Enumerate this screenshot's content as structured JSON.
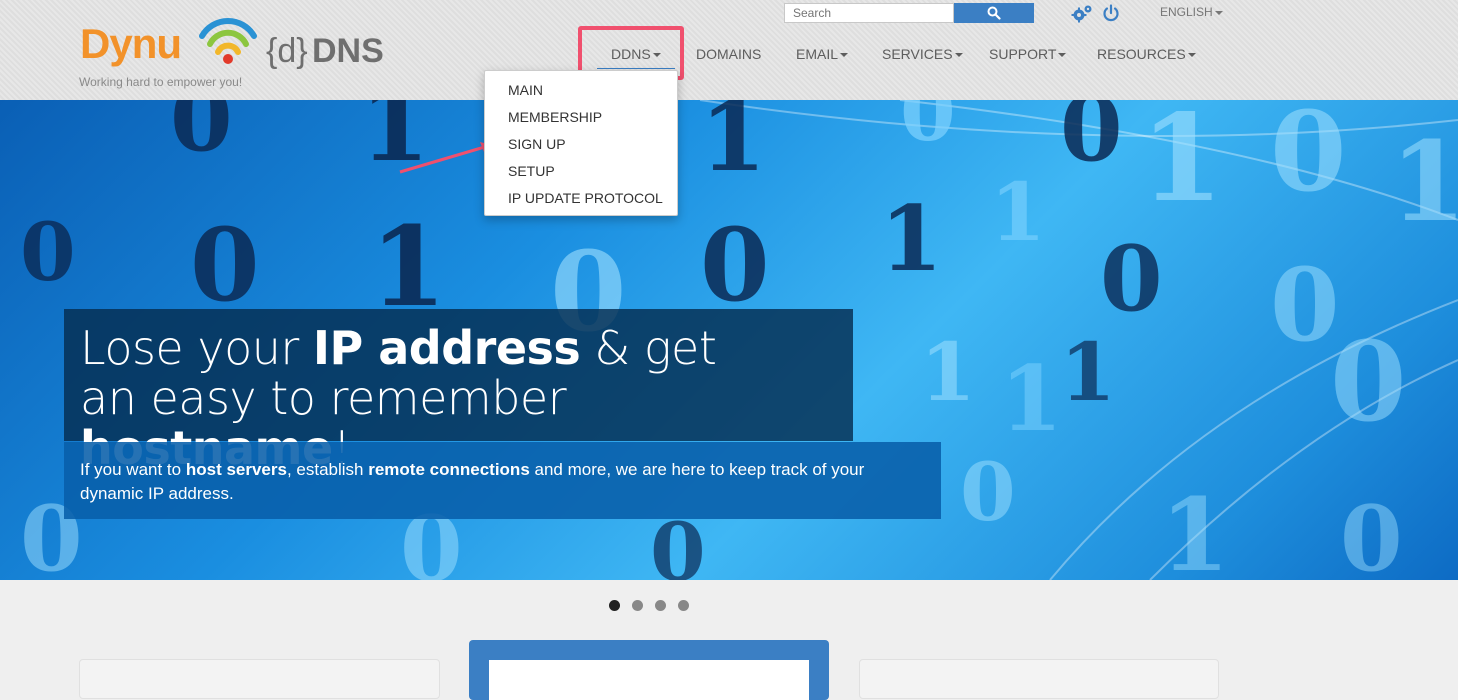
{
  "brand": {
    "logo_main": "Dynu",
    "logo_brace": "{d}",
    "logo_dns": "DNS",
    "tagline": "Working hard to empower you!",
    "accent_color": "#3b7fc4",
    "logo_color": "#f2922a"
  },
  "topbar": {
    "search_placeholder": "Search",
    "search_icon": "search-icon",
    "settings_icon": "gear-icon",
    "logout_icon": "power-icon",
    "language": "ENGLISH"
  },
  "nav": {
    "items": [
      {
        "label": "DDNS",
        "dropdown": true,
        "active": true
      },
      {
        "label": "DOMAINS",
        "dropdown": false
      },
      {
        "label": "EMAIL",
        "dropdown": true
      },
      {
        "label": "SERVICES",
        "dropdown": true
      },
      {
        "label": "SUPPORT",
        "dropdown": true
      },
      {
        "label": "RESOURCES",
        "dropdown": true
      }
    ]
  },
  "ddns_menu": {
    "items": [
      "MAIN",
      "MEMBERSHIP",
      "SIGN UP",
      "SETUP",
      "IP UPDATE PROTOCOL"
    ]
  },
  "hero": {
    "headline_line1_pre": "Lose your ",
    "headline_line1_bold": "IP address",
    "headline_line1_post": " & get",
    "headline_line2_pre": "an easy to remember ",
    "headline_line2_bold": "hostname",
    "headline_line2_post": "!",
    "sub_pre": "If you want to ",
    "sub_bold1": "host servers",
    "sub_mid": ", establish ",
    "sub_bold2": "remote connections",
    "sub_post": " and more, we are here to keep track of your dynamic IP address."
  },
  "carousel": {
    "slide_count": 4,
    "active_index": 0
  },
  "annotation": {
    "highlight_color": "#f0506e"
  }
}
